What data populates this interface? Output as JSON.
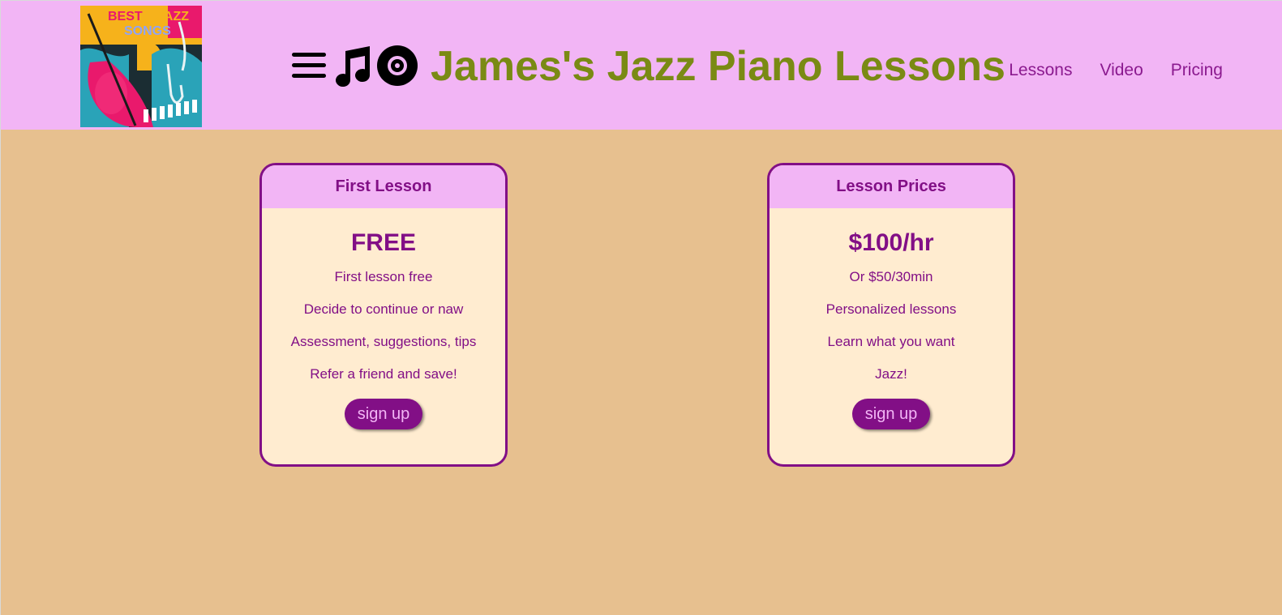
{
  "header": {
    "logo": {
      "line1_a": "BEST",
      "line1_b": "JAZZ",
      "line2": "SONGS"
    },
    "icons": [
      "menu-icon",
      "music-note-icon",
      "vinyl-record-icon"
    ],
    "title": "James's Jazz Piano Lessons",
    "nav": [
      "Lessons",
      "Video",
      "Pricing"
    ]
  },
  "cards": [
    {
      "heading": "First Lesson",
      "price": "FREE",
      "features": [
        "First lesson free",
        "Decide to continue or naw",
        "Assessment, suggestions, tips",
        "Refer a friend and save!"
      ],
      "button": "sign up"
    },
    {
      "heading": "Lesson Prices",
      "price": "$100/hr",
      "features": [
        "Or $50/30min",
        "Personalized lessons",
        "Learn what you want",
        "Jazz!"
      ],
      "button": "sign up"
    }
  ],
  "colors": {
    "header_bg": "#f2b5f5",
    "page_bg": "#e7c08f",
    "accent": "#820f86",
    "title": "#7a8a14",
    "card_bg": "#ffecd0"
  }
}
